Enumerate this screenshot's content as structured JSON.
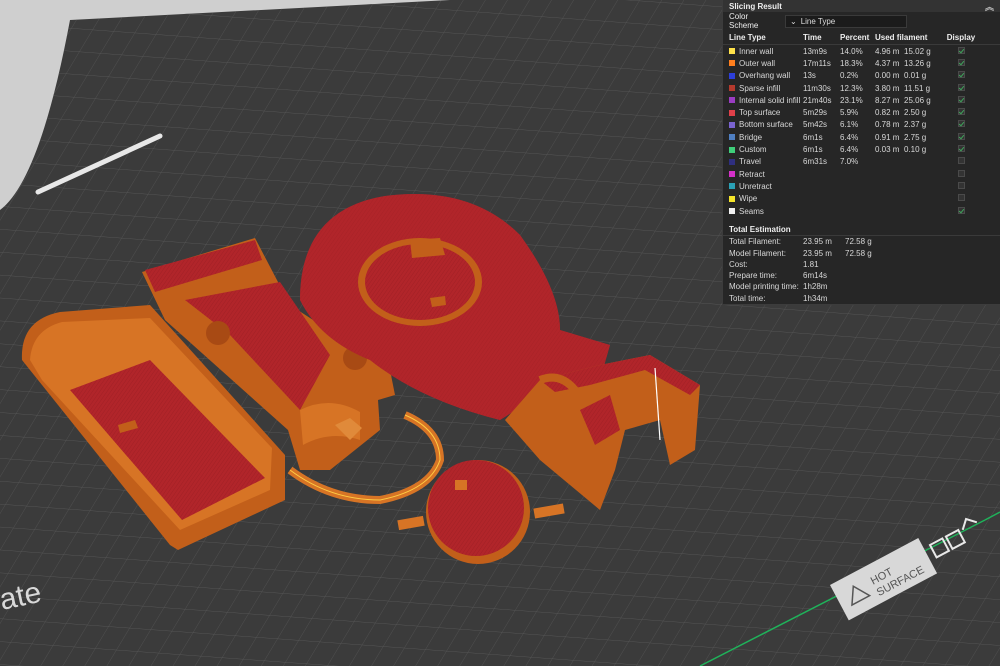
{
  "panel": {
    "title": "Slicing Result",
    "collapse_glyph": "︽",
    "color_scheme_label": "Color Scheme",
    "color_scheme_value": "Line Type",
    "columns": {
      "type": "Line Type",
      "time": "Time",
      "percent": "Percent",
      "used": "Used filament",
      "display": "Display"
    },
    "rows": [
      {
        "name": "Inner wall",
        "color": "#ffe24a",
        "time": "13m9s",
        "percent": "14.0%",
        "len": "4.96 m",
        "weight": "15.02 g",
        "checked": true
      },
      {
        "name": "Outer wall",
        "color": "#ff7f1e",
        "time": "17m11s",
        "percent": "18.3%",
        "len": "4.37 m",
        "weight": "13.26 g",
        "checked": true
      },
      {
        "name": "Overhang wall",
        "color": "#2d3fd9",
        "time": "13s",
        "percent": "0.2%",
        "len": "0.00 m",
        "weight": "0.01 g",
        "checked": true
      },
      {
        "name": "Sparse infill",
        "color": "#b53a2d",
        "time": "11m30s",
        "percent": "12.3%",
        "len": "3.80 m",
        "weight": "11.51 g",
        "checked": true
      },
      {
        "name": "Internal solid infill",
        "color": "#9a3cc2",
        "time": "21m40s",
        "percent": "23.1%",
        "len": "8.27 m",
        "weight": "25.06 g",
        "checked": true
      },
      {
        "name": "Top surface",
        "color": "#e0404a",
        "time": "5m29s",
        "percent": "5.9%",
        "len": "0.82 m",
        "weight": "2.50 g",
        "checked": true
      },
      {
        "name": "Bottom surface",
        "color": "#7a63d0",
        "time": "5m42s",
        "percent": "6.1%",
        "len": "0.78 m",
        "weight": "2.37 g",
        "checked": true
      },
      {
        "name": "Bridge",
        "color": "#4f7fc2",
        "time": "6m1s",
        "percent": "6.4%",
        "len": "0.91 m",
        "weight": "2.75 g",
        "checked": true
      },
      {
        "name": "Custom",
        "color": "#3fcf7a",
        "time": "6m1s",
        "percent": "6.4%",
        "len": "0.03 m",
        "weight": "0.10 g",
        "checked": true
      },
      {
        "name": "Travel",
        "color": "#2f2f80",
        "time": "6m31s",
        "percent": "7.0%",
        "len": "",
        "weight": "",
        "checked": false
      },
      {
        "name": "Retract",
        "color": "#d430c8",
        "time": "",
        "percent": "",
        "len": "",
        "weight": "",
        "checked": false
      },
      {
        "name": "Unretract",
        "color": "#2aa0b5",
        "time": "",
        "percent": "",
        "len": "",
        "weight": "",
        "checked": false
      },
      {
        "name": "Wipe",
        "color": "#f5e52a",
        "time": "",
        "percent": "",
        "len": "",
        "weight": "",
        "checked": false
      },
      {
        "name": "Seams",
        "color": "#f0f0f0",
        "time": "",
        "percent": "",
        "len": "",
        "weight": "",
        "checked": true
      }
    ],
    "estimation_title": "Total Estimation",
    "estimation": [
      {
        "label": "Total Filament:",
        "v1": "23.95 m",
        "v2": "72.58 g"
      },
      {
        "label": "Model Filament:",
        "v1": "23.95 m",
        "v2": "72.58 g"
      },
      {
        "label": "Cost:",
        "v1": "1.81",
        "v2": ""
      },
      {
        "label": "Prepare time:",
        "v1": "6m14s",
        "v2": ""
      },
      {
        "label": "Model printing time:",
        "v1": "1h28m",
        "v2": ""
      },
      {
        "label": "Total time:",
        "v1": "1h34m",
        "v2": ""
      }
    ]
  },
  "bed": {
    "hot_surface_line1": "HOT",
    "hot_surface_line2": "SURFACE",
    "edge_text": "ate"
  },
  "colors": {
    "plate": "#3c3c3c",
    "grid": "#5a5a5a",
    "part_wall": "#c8661e",
    "part_top": "#b3262b",
    "accent_green": "#1fb25a"
  }
}
